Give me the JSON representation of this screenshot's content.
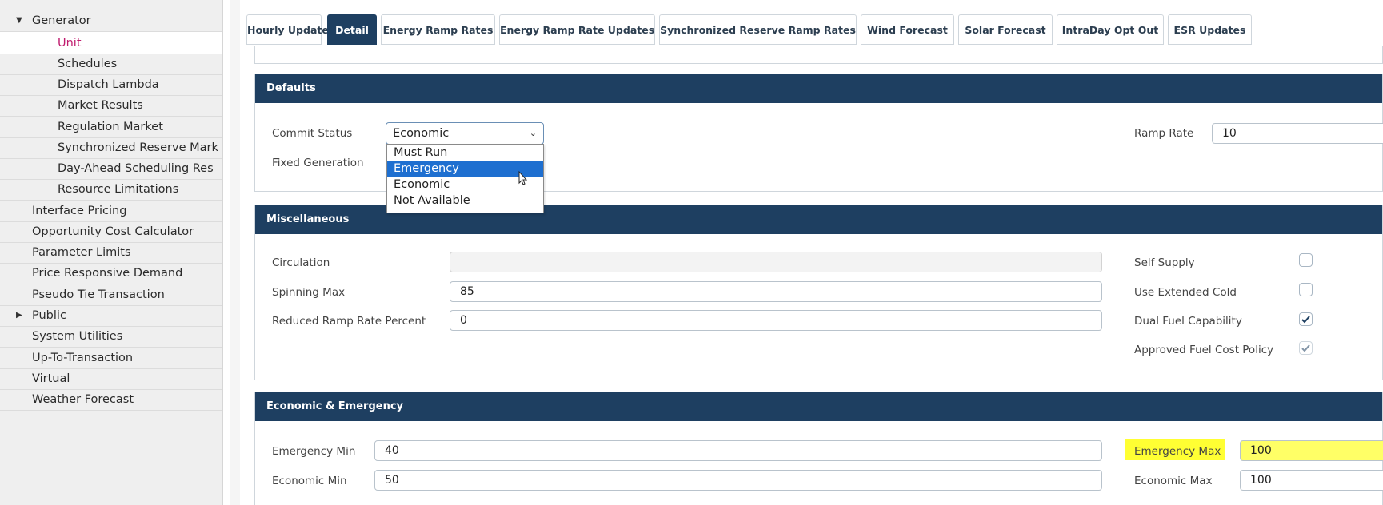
{
  "sidebar": {
    "items": [
      {
        "label": "Generator"
      },
      {
        "label": "Unit"
      },
      {
        "label": "Schedules"
      },
      {
        "label": "Dispatch Lambda"
      },
      {
        "label": "Market Results"
      },
      {
        "label": "Regulation Market"
      },
      {
        "label": "Synchronized Reserve Mark"
      },
      {
        "label": "Day-Ahead Scheduling Res"
      },
      {
        "label": "Resource Limitations"
      },
      {
        "label": "Interface Pricing"
      },
      {
        "label": "Opportunity Cost Calculator"
      },
      {
        "label": "Parameter Limits"
      },
      {
        "label": "Price Responsive Demand"
      },
      {
        "label": "Pseudo Tie Transaction"
      },
      {
        "label": "Public"
      },
      {
        "label": "System Utilities"
      },
      {
        "label": "Up-To-Transaction"
      },
      {
        "label": "Virtual"
      },
      {
        "label": "Weather Forecast"
      }
    ]
  },
  "tabs": [
    {
      "label": "Hourly Updates"
    },
    {
      "label": "Detail"
    },
    {
      "label": "Energy Ramp Rates"
    },
    {
      "label": "Energy Ramp Rate Updates"
    },
    {
      "label": "Synchronized Reserve Ramp Rates"
    },
    {
      "label": "Wind Forecast"
    },
    {
      "label": "Solar Forecast"
    },
    {
      "label": "IntraDay Opt Out"
    },
    {
      "label": "ESR Updates"
    }
  ],
  "defaults": {
    "title": "Defaults",
    "commit_status_label": "Commit Status",
    "commit_status_value": "Economic",
    "fixed_generation_label": "Fixed Generation",
    "ramp_rate_label": "Ramp Rate",
    "ramp_rate_value": "10",
    "dropdown_options": [
      {
        "label": "Must Run"
      },
      {
        "label": "Emergency"
      },
      {
        "label": "Economic"
      },
      {
        "label": "Not Available"
      }
    ]
  },
  "misc": {
    "title": "Miscellaneous",
    "circulation_label": "Circulation",
    "circulation_value": "",
    "spinning_max_label": "Spinning Max",
    "spinning_max_value": "85",
    "reduced_ramp_label": "Reduced Ramp Rate Percent",
    "reduced_ramp_value": "0",
    "self_supply_label": "Self Supply",
    "use_extended_cold_label": "Use Extended Cold",
    "dual_fuel_label": "Dual Fuel Capability",
    "approved_fuel_label": "Approved Fuel Cost Policy"
  },
  "econ": {
    "title": "Economic & Emergency",
    "emergency_min_label": "Emergency Min",
    "emergency_min_value": "40",
    "economic_min_label": "Economic Min",
    "economic_min_value": "50",
    "emergency_max_label": "Emergency Max",
    "emergency_max_value": "100",
    "economic_max_label": "Economic Max",
    "economic_max_value": "100"
  },
  "colors": {
    "header_navy": "#1e3f61",
    "active_pink": "#c01b6e",
    "highlight": "#1e6fd0",
    "marker_yellow": "#ffff33"
  }
}
